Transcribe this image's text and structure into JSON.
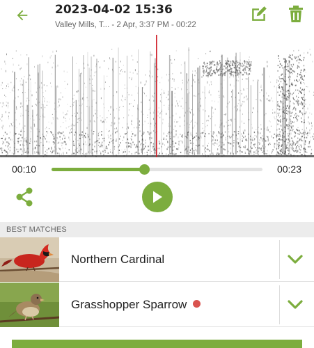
{
  "header": {
    "title": "2023-04-02 15:36",
    "subtitle": "Valley Mills, T... - 2 Apr, 3:37 PM - 00:22"
  },
  "player": {
    "current_time": "00:10",
    "total_time": "00:23",
    "progress": 0.44
  },
  "icons": {
    "back": "arrow-left-icon",
    "edit": "edit-icon",
    "delete": "trash-icon",
    "share": "share-icon",
    "play": "play-icon",
    "expand": "chevron-down-icon"
  },
  "colors": {
    "accent": "#7cad3e",
    "playhead": "#d0202a",
    "new_badge": "#d9534f"
  },
  "matches_section": {
    "title": "BEST MATCHES",
    "items": [
      {
        "name": "Northern Cardinal",
        "new": false
      },
      {
        "name": "Grasshopper Sparrow",
        "new": true
      }
    ]
  }
}
